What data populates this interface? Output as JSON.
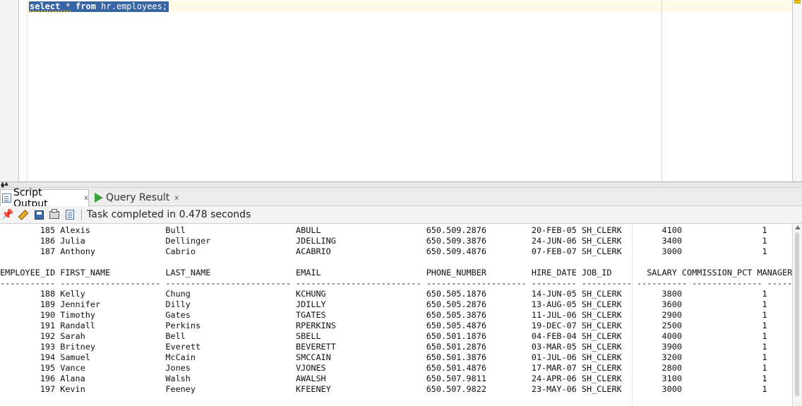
{
  "editor": {
    "sql_keyword1": "select",
    "sql_star": " * ",
    "sql_keyword2": "from",
    "sql_rest": " hr.employees;"
  },
  "colors": {
    "selection": "#3764a2",
    "current_line": "#fdfbe6",
    "overview_marker": "#f5c400",
    "run_icon": "#3aa33a",
    "pin_icon": "#d01818"
  },
  "tabs": [
    {
      "label": "Script Output",
      "close": "x",
      "icon": "script-icon",
      "active": true
    },
    {
      "label": "Query Result",
      "close": "x",
      "icon": "play-icon",
      "active": false
    }
  ],
  "toolbar": {
    "icons": [
      "pin-icon",
      "eraser-icon",
      "save-icon",
      "print-icon",
      "document-icon"
    ],
    "status": "Task completed in 0.478 seconds"
  },
  "output": {
    "lines": [
      "        185 Alexis               Bull                      ABULL                     650.509.2876         20-FEB-05 SH_CLERK        4100                1",
      "        186 Julia                Dellinger                 JDELLING                  650.509.3876         24-JUN-06 SH_CLERK        3400                1",
      "        187 Anthony              Cabrio                    ACABRIO                   650.509.4876         07-FEB-07 SH_CLERK        3000                1",
      "",
      "EMPLOYEE_ID FIRST_NAME           LAST_NAME                 EMAIL                     PHONE_NUMBER         HIRE_DATE JOB_ID       SALARY COMMISSION_PCT MANAGER_",
      "----------- -------------------- ------------------------- ------------------------- -------------------- --------- ---------- ---------- -------------- --------",
      "        188 Kelly                Chung                     KCHUNG                    650.505.1876         14-JUN-05 SH_CLERK        3800                1",
      "        189 Jennifer             Dilly                     JDILLY                    650.505.2876         13-AUG-05 SH_CLERK        3600                1",
      "        190 Timothy              Gates                     TGATES                    650.505.3876         11-JUL-06 SH_CLERK        2900                1",
      "        191 Randall              Perkins                   RPERKINS                  650.505.4876         19-DEC-07 SH_CLERK        2500                1",
      "        192 Sarah                Bell                      SBELL                     650.501.1876         04-FEB-04 SH_CLERK        4000                1",
      "        193 Britney              Everett                   BEVERETT                  650.501.2876         03-MAR-05 SH_CLERK        3900                1",
      "        194 Samuel               McCain                    SMCCAIN                   650.501.3876         01-JUL-06 SH_CLERK        3200                1",
      "        195 Vance                Jones                     VJONES                    650.501.4876         17-MAR-07 SH_CLERK        2800                1",
      "        196 Alana                Walsh                     AWALSH                    650.507.9811         24-APR-06 SH_CLERK        3100                1",
      "        197 Kevin                Feeney                    KFEENEY                   650.507.9822         23-MAY-06 SH_CLERK        3000                1"
    ]
  }
}
